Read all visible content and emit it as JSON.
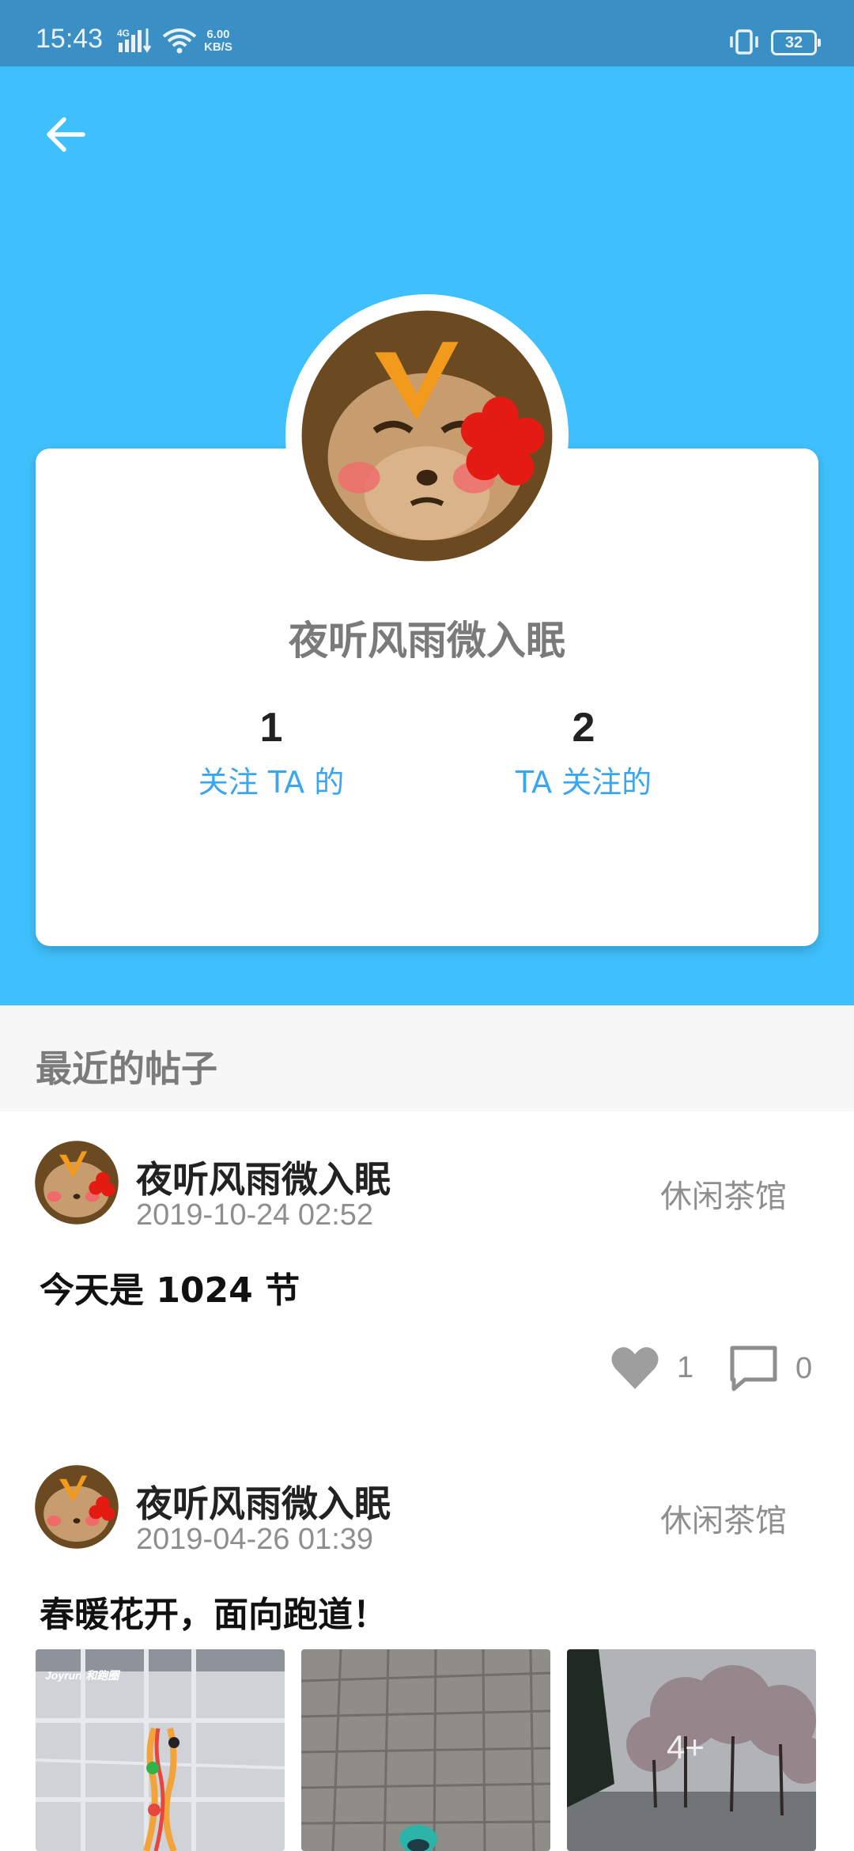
{
  "status_bar": {
    "time": "15:43",
    "network": "4G",
    "speed_value": "6.00",
    "speed_unit": "KB/S",
    "battery": "32"
  },
  "profile": {
    "nickname": "夜听风雨微入眠",
    "followers_count": "1",
    "followers_label": "关注 TA 的",
    "following_count": "2",
    "following_label": "TA 关注的"
  },
  "section": {
    "title": "最近的帖子"
  },
  "posts": [
    {
      "author": "夜听风雨微入眠",
      "time": "2019-10-24 02:52",
      "forum": "休闲茶馆",
      "content": "今天是 1024 节",
      "likes": "1",
      "comments": "0"
    },
    {
      "author": "夜听风雨微入眠",
      "time": "2019-04-26 01:39",
      "forum": "休闲茶馆",
      "content": "春暖花开，面向跑道！",
      "images_more": "4+",
      "map_app": "Joyrun·和跑圈"
    }
  ],
  "colors": {
    "status_bar": "#3a8fc4",
    "header": "#3fc0fc",
    "accent": "#3aa6f0",
    "section_bg": "#f7f7f7"
  },
  "icons": [
    "arrow-left-icon",
    "heart-icon",
    "comment-icon",
    "signal-icon",
    "wifi-icon",
    "vibrate-icon"
  ]
}
